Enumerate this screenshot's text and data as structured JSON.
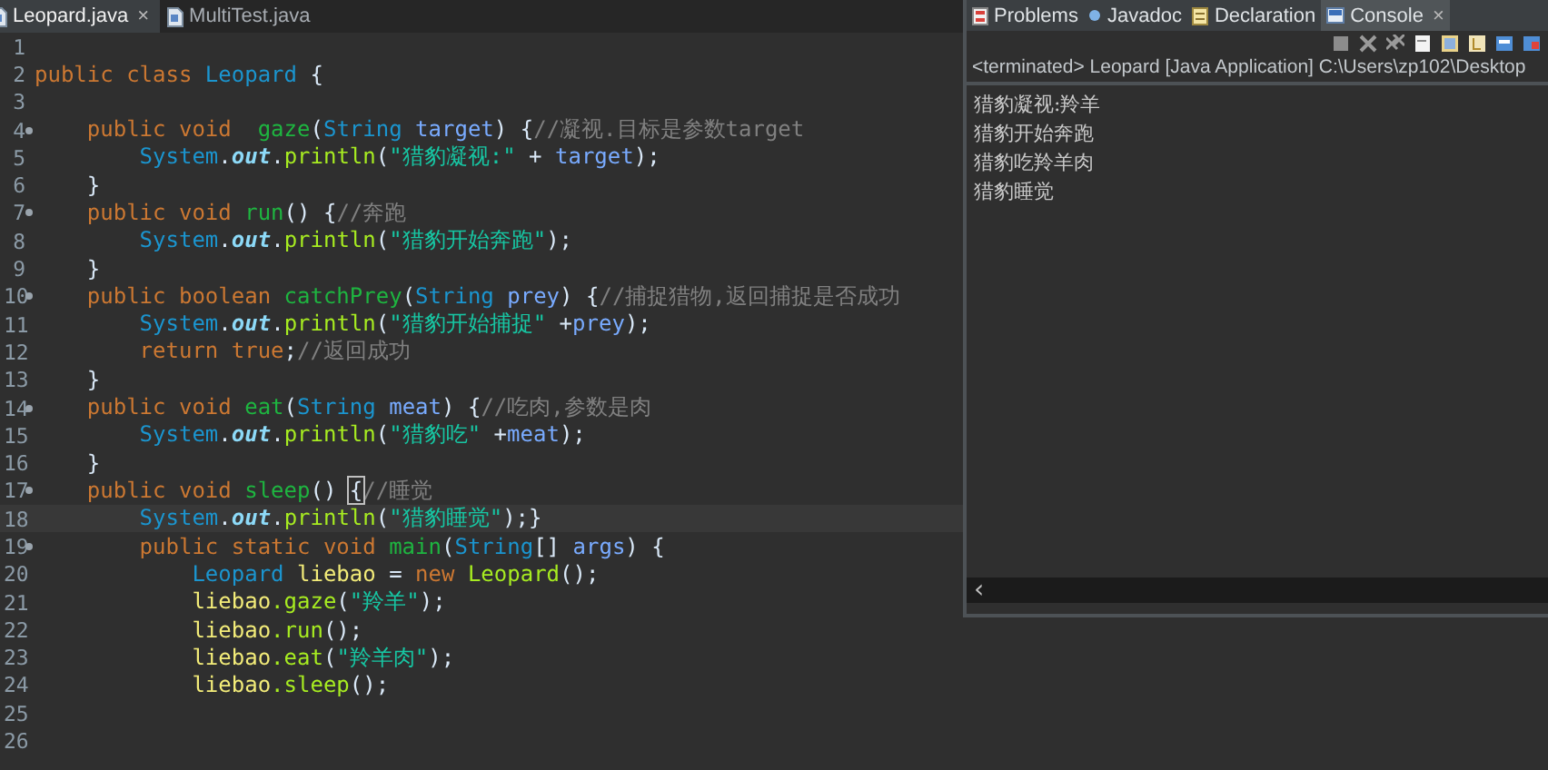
{
  "editor": {
    "tabs": [
      {
        "label": "Leopard.java",
        "selected": true,
        "close": "×"
      },
      {
        "label": "MultiTest.java",
        "selected": false
      }
    ],
    "lines": [
      {
        "number": "1",
        "fold": false,
        "current": false
      },
      {
        "number": "2",
        "fold": false,
        "current": false,
        "tokens": [
          {
            "text": "public class ",
            "kind": "kw"
          },
          {
            "text": "Leopard",
            "kind": "type"
          },
          {
            "text": " {",
            "kind": "pl"
          }
        ]
      },
      {
        "number": "3",
        "fold": false,
        "current": false
      },
      {
        "number": "4",
        "fold": true,
        "current": false,
        "tokens": [
          {
            "text": "    public void  ",
            "kind": "kw"
          },
          {
            "text": "gaze",
            "kind": "decl"
          },
          {
            "text": "(",
            "kind": "pl"
          },
          {
            "text": "String ",
            "kind": "type"
          },
          {
            "text": "target",
            "kind": "param"
          },
          {
            "text": ") {",
            "kind": "pl"
          },
          {
            "text": "//凝视.目标是参数target",
            "kind": "comment"
          }
        ]
      },
      {
        "number": "5",
        "fold": false,
        "current": false,
        "tokens": [
          {
            "text": "        System",
            "kind": "type"
          },
          {
            "text": ".",
            "kind": "pl"
          },
          {
            "text": "out",
            "kind": "field"
          },
          {
            "text": ".",
            "kind": "pl"
          },
          {
            "text": "println",
            "kind": "call"
          },
          {
            "text": "(",
            "kind": "pl"
          },
          {
            "text": "\"猎豹凝视:\"",
            "kind": "str"
          },
          {
            "text": " + ",
            "kind": "pl"
          },
          {
            "text": "target",
            "kind": "param"
          },
          {
            "text": ");",
            "kind": "pl"
          }
        ]
      },
      {
        "number": "6",
        "fold": false,
        "current": false,
        "tokens": [
          {
            "text": "    }",
            "kind": "pl"
          }
        ]
      },
      {
        "number": "7",
        "fold": true,
        "current": false,
        "tokens": [
          {
            "text": "    public void ",
            "kind": "kw"
          },
          {
            "text": "run",
            "kind": "decl"
          },
          {
            "text": "() {",
            "kind": "pl"
          },
          {
            "text": "//奔跑",
            "kind": "comment"
          }
        ]
      },
      {
        "number": "8",
        "fold": false,
        "current": false,
        "tokens": [
          {
            "text": "        System",
            "kind": "type"
          },
          {
            "text": ".",
            "kind": "pl"
          },
          {
            "text": "out",
            "kind": "field"
          },
          {
            "text": ".",
            "kind": "pl"
          },
          {
            "text": "println",
            "kind": "call"
          },
          {
            "text": "(",
            "kind": "pl"
          },
          {
            "text": "\"猎豹开始奔跑\"",
            "kind": "str"
          },
          {
            "text": ");",
            "kind": "pl"
          }
        ]
      },
      {
        "number": "9",
        "fold": false,
        "current": false,
        "tokens": [
          {
            "text": "    }",
            "kind": "pl"
          }
        ]
      },
      {
        "number": "10",
        "fold": true,
        "current": false,
        "tokens": [
          {
            "text": "    public boolean ",
            "kind": "kw"
          },
          {
            "text": "catchPrey",
            "kind": "decl"
          },
          {
            "text": "(",
            "kind": "pl"
          },
          {
            "text": "String ",
            "kind": "type"
          },
          {
            "text": "prey",
            "kind": "param"
          },
          {
            "text": ") {",
            "kind": "pl"
          },
          {
            "text": "//捕捉猎物,返回捕捉是否成功",
            "kind": "comment"
          }
        ]
      },
      {
        "number": "11",
        "fold": false,
        "current": false,
        "tokens": [
          {
            "text": "        System",
            "kind": "type"
          },
          {
            "text": ".",
            "kind": "pl"
          },
          {
            "text": "out",
            "kind": "field"
          },
          {
            "text": ".",
            "kind": "pl"
          },
          {
            "text": "println",
            "kind": "call"
          },
          {
            "text": "(",
            "kind": "pl"
          },
          {
            "text": "\"猎豹开始捕捉\"",
            "kind": "str"
          },
          {
            "text": " +",
            "kind": "pl"
          },
          {
            "text": "prey",
            "kind": "param"
          },
          {
            "text": ");",
            "kind": "pl"
          }
        ]
      },
      {
        "number": "12",
        "fold": false,
        "current": false,
        "tokens": [
          {
            "text": "        return true",
            "kind": "kw"
          },
          {
            "text": ";",
            "kind": "pl"
          },
          {
            "text": "//返回成功",
            "kind": "comment"
          }
        ]
      },
      {
        "number": "13",
        "fold": false,
        "current": false,
        "tokens": [
          {
            "text": "    }",
            "kind": "pl"
          }
        ]
      },
      {
        "number": "14",
        "fold": true,
        "current": false,
        "tokens": [
          {
            "text": "    public void ",
            "kind": "kw"
          },
          {
            "text": "eat",
            "kind": "decl"
          },
          {
            "text": "(",
            "kind": "pl"
          },
          {
            "text": "String ",
            "kind": "type"
          },
          {
            "text": "meat",
            "kind": "param"
          },
          {
            "text": ") {",
            "kind": "pl"
          },
          {
            "text": "//吃肉,参数是肉",
            "kind": "comment"
          }
        ]
      },
      {
        "number": "15",
        "fold": false,
        "current": false,
        "tokens": [
          {
            "text": "        System",
            "kind": "type"
          },
          {
            "text": ".",
            "kind": "pl"
          },
          {
            "text": "out",
            "kind": "field"
          },
          {
            "text": ".",
            "kind": "pl"
          },
          {
            "text": "println",
            "kind": "call"
          },
          {
            "text": "(",
            "kind": "pl"
          },
          {
            "text": "\"猎豹吃\"",
            "kind": "str"
          },
          {
            "text": " +",
            "kind": "pl"
          },
          {
            "text": "meat",
            "kind": "param"
          },
          {
            "text": ");",
            "kind": "pl"
          }
        ]
      },
      {
        "number": "16",
        "fold": false,
        "current": false,
        "tokens": [
          {
            "text": "    }",
            "kind": "pl"
          }
        ]
      },
      {
        "number": "17",
        "fold": true,
        "current": false,
        "tokens": [
          {
            "text": "    public void ",
            "kind": "kw"
          },
          {
            "text": "sleep",
            "kind": "decl"
          },
          {
            "text": "() ",
            "kind": "pl"
          },
          {
            "text": "{",
            "kind": "match"
          },
          {
            "text": "//睡觉",
            "kind": "comment"
          }
        ]
      },
      {
        "number": "18",
        "fold": false,
        "current": true,
        "tokens": [
          {
            "text": "        System",
            "kind": "type"
          },
          {
            "text": ".",
            "kind": "pl"
          },
          {
            "text": "out",
            "kind": "field"
          },
          {
            "text": ".",
            "kind": "pl"
          },
          {
            "text": "println",
            "kind": "call"
          },
          {
            "text": "(",
            "kind": "pl"
          },
          {
            "text": "\"猎豹睡觉\"",
            "kind": "str"
          },
          {
            "text": ");}",
            "kind": "pl"
          }
        ]
      },
      {
        "number": "19",
        "fold": true,
        "current": false,
        "tokens": [
          {
            "text": "        public static void ",
            "kind": "kw"
          },
          {
            "text": "main",
            "kind": "decl"
          },
          {
            "text": "(",
            "kind": "pl"
          },
          {
            "text": "String",
            "kind": "type"
          },
          {
            "text": "[] ",
            "kind": "pl"
          },
          {
            "text": "args",
            "kind": "param"
          },
          {
            "text": ") {",
            "kind": "pl"
          }
        ]
      },
      {
        "number": "20",
        "fold": false,
        "current": false,
        "tokens": [
          {
            "text": "            Leopard ",
            "kind": "type"
          },
          {
            "text": "liebao",
            "kind": "local"
          },
          {
            "text": " = ",
            "kind": "pl"
          },
          {
            "text": "new ",
            "kind": "kw"
          },
          {
            "text": "Leopard",
            "kind": "call"
          },
          {
            "text": "();",
            "kind": "pl"
          }
        ]
      },
      {
        "number": "21",
        "fold": false,
        "current": false,
        "tokens": [
          {
            "text": "            liebao",
            "kind": "local"
          },
          {
            "text": ".gaze",
            "kind": "call"
          },
          {
            "text": "(",
            "kind": "pl"
          },
          {
            "text": "\"羚羊\"",
            "kind": "str"
          },
          {
            "text": ");",
            "kind": "pl"
          }
        ]
      },
      {
        "number": "22",
        "fold": false,
        "current": false,
        "tokens": [
          {
            "text": "            liebao",
            "kind": "local"
          },
          {
            "text": ".run",
            "kind": "call"
          },
          {
            "text": "();",
            "kind": "pl"
          }
        ]
      },
      {
        "number": "23",
        "fold": false,
        "current": false,
        "tokens": [
          {
            "text": "            liebao",
            "kind": "local"
          },
          {
            "text": ".eat",
            "kind": "call"
          },
          {
            "text": "(",
            "kind": "pl"
          },
          {
            "text": "\"羚羊肉\"",
            "kind": "str"
          },
          {
            "text": ");",
            "kind": "pl"
          }
        ]
      },
      {
        "number": "24",
        "fold": false,
        "current": false,
        "tokens": [
          {
            "text": "            liebao",
            "kind": "local"
          },
          {
            "text": ".sleep",
            "kind": "call"
          },
          {
            "text": "();",
            "kind": "pl"
          }
        ]
      },
      {
        "number": "25",
        "fold": false,
        "current": false
      },
      {
        "number": "26",
        "fold": false,
        "current": false
      }
    ]
  },
  "console": {
    "tabs": [
      {
        "label": "Problems",
        "kind": "problems",
        "selected": false
      },
      {
        "label": "Javadoc",
        "kind": "javadoc",
        "selected": false
      },
      {
        "label": "Declaration",
        "kind": "declaration",
        "selected": false
      },
      {
        "label": "Console",
        "kind": "console",
        "selected": true,
        "close": "×"
      }
    ],
    "status": "<terminated> Leopard [Java Application] C:\\Users\\zp102\\Desktop",
    "output": [
      "猎豹凝视:羚羊",
      "猎豹开始奔跑",
      "猎豹吃羚羊肉",
      "猎豹睡觉"
    ],
    "scroll_left": "‹"
  }
}
